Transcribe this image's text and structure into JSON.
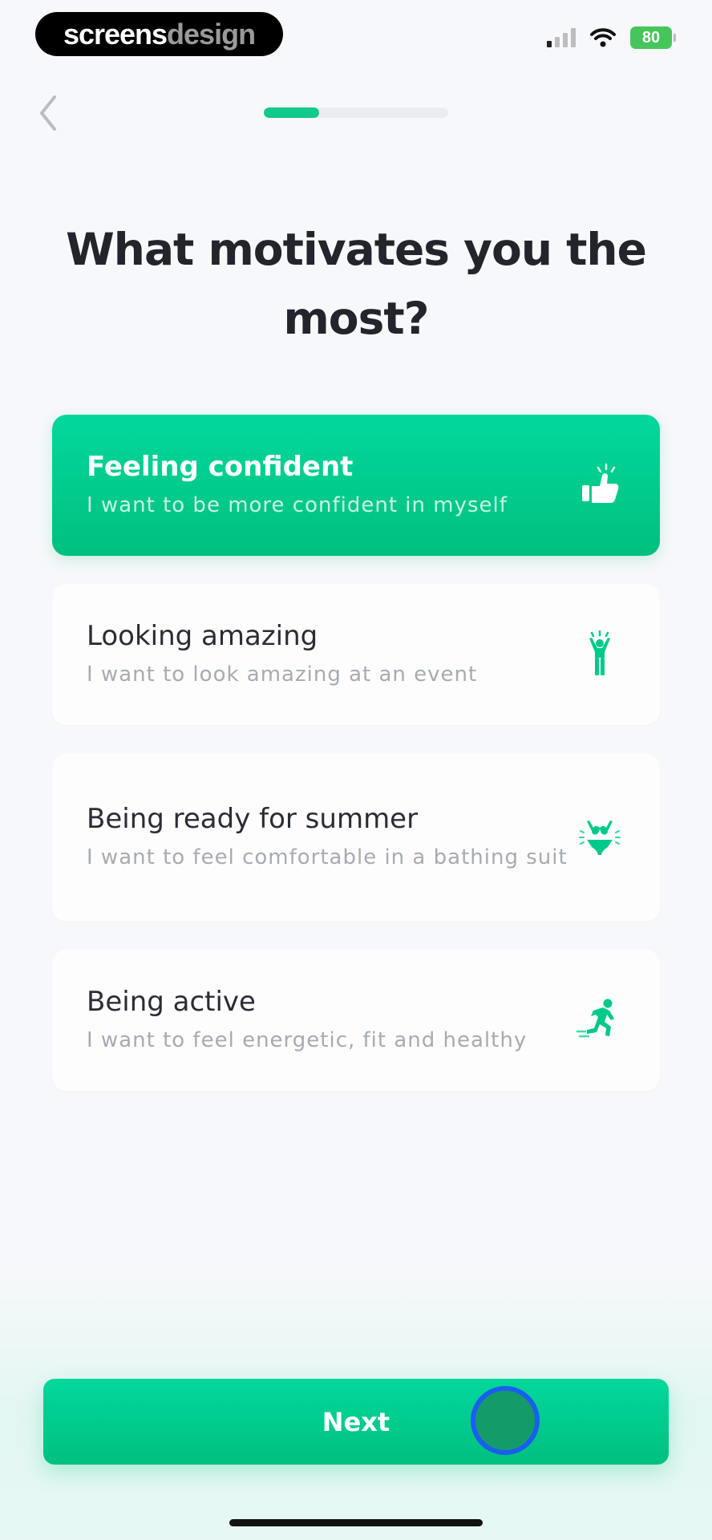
{
  "status_bar": {
    "brand_part1": "screens",
    "brand_part2": "design",
    "battery": "80"
  },
  "progress": {
    "value": 0.3
  },
  "title": "What motivates you the most?",
  "options": [
    {
      "title": "Feeling confident",
      "subtitle": "I want to be more confident in myself",
      "icon": "thumbs-up-icon",
      "selected": true
    },
    {
      "title": "Looking amazing",
      "subtitle": "I want to look amazing at an event",
      "icon": "cheering-person-icon",
      "selected": false
    },
    {
      "title": "Being ready for summer",
      "subtitle": "I want to feel comfortable in a bathing suit",
      "icon": "bikini-icon",
      "selected": false
    },
    {
      "title": "Being active",
      "subtitle": "I want to feel energetic, fit and healthy",
      "icon": "running-person-icon",
      "selected": false
    }
  ],
  "next_button": {
    "label": "Next"
  },
  "colors": {
    "accent": "#00c98a",
    "accent_dark": "#00c07f",
    "title": "#23252d",
    "subtitle": "#a7abb2"
  }
}
